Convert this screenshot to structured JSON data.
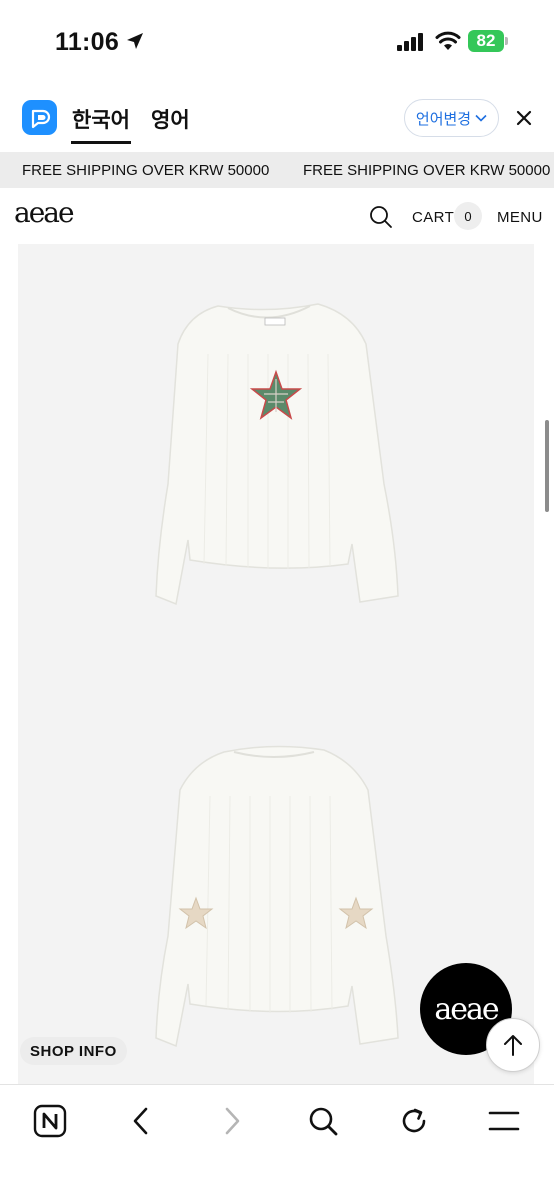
{
  "status_bar": {
    "time": "11:06",
    "battery_level": "82",
    "icons": [
      "location-arrow-icon",
      "signal-icon",
      "wifi-icon",
      "battery-icon"
    ]
  },
  "translate_bar": {
    "tabs": [
      {
        "label": "한국어",
        "active": true
      },
      {
        "label": "영어",
        "active": false
      }
    ],
    "change_button": "언어변경",
    "colors": {
      "accent": "#1e6fe0",
      "papago": "#1e90ff"
    }
  },
  "announcement": {
    "items": [
      "FREE SHIPPING OVER KRW 50000",
      "FREE SHIPPING OVER KRW 50000"
    ]
  },
  "header": {
    "logo": "aeae",
    "cart_label": "CART",
    "cart_count": "0",
    "menu_label": "MENU"
  },
  "product": {
    "images": [
      "front-view",
      "back-view"
    ],
    "front_tag": "aeae"
  },
  "floating": {
    "shop_info": "SHOP INFO",
    "badge_logo": "aeae"
  },
  "toolbar": {
    "buttons": [
      "naver-home-icon",
      "back-arrow-icon",
      "forward-arrow-icon",
      "search-icon",
      "refresh-icon",
      "hamburger-menu-icon"
    ]
  }
}
